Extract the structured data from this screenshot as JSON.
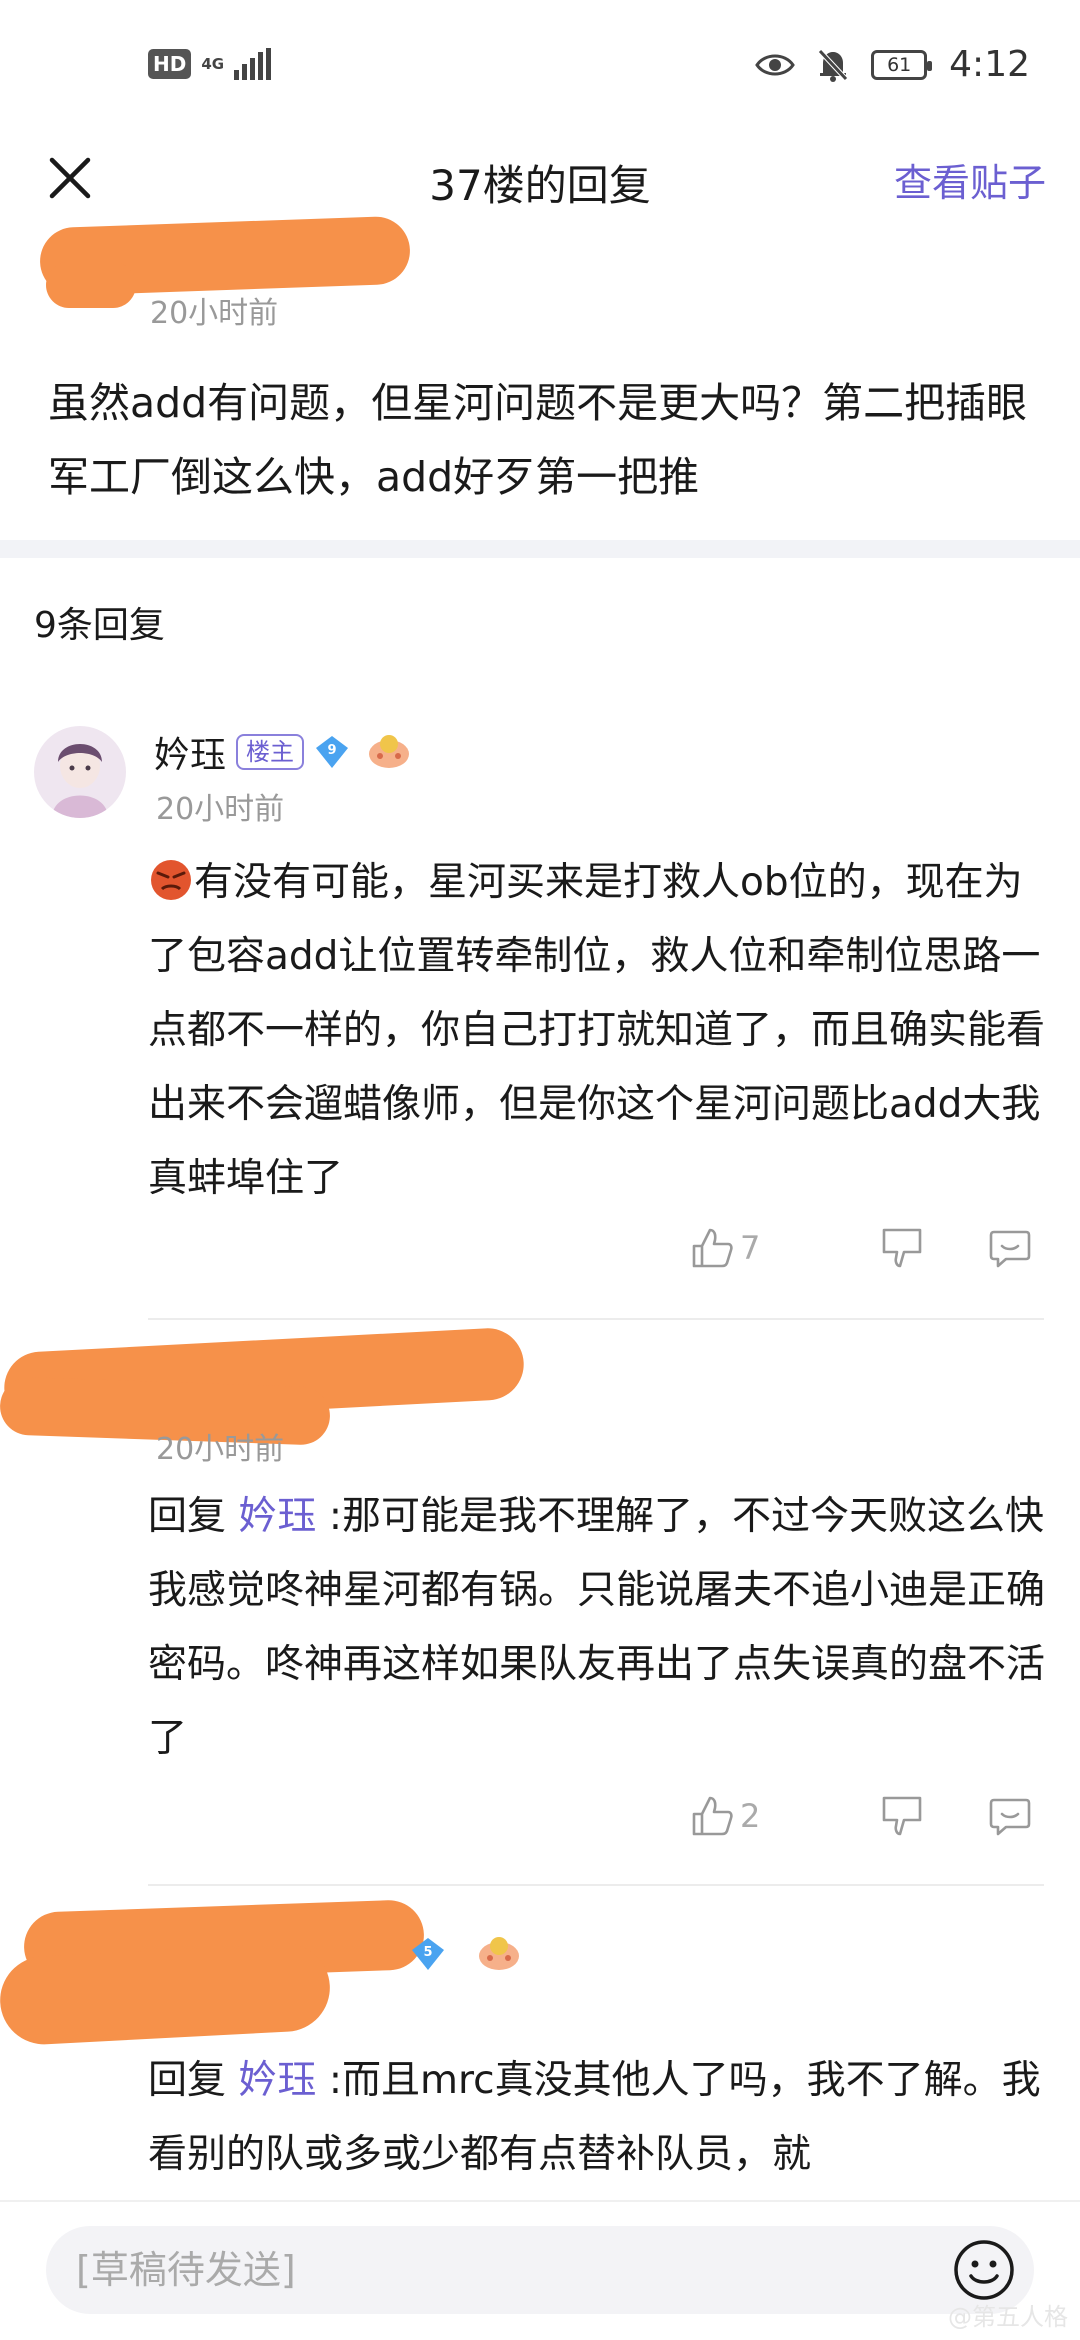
{
  "status": {
    "hd": "HD",
    "net": "4G",
    "battery": "61",
    "time": "4:12"
  },
  "nav": {
    "title": "37楼的回复",
    "link": "查看贴子"
  },
  "post": {
    "time": "20小时前",
    "text": "虽然add有问题，但星河问题不是更大吗？第二把插眼军工厂倒这么快，add好歹第一把推"
  },
  "reply_count": "9条回复",
  "replies": [
    {
      "name": "妗珏",
      "tag": "楼主",
      "level": "9",
      "time": "20小时前",
      "text": "有没有可能，星河买来是打救人ob位的，现在为了包容add让位置转牵制位，救人位和牵制位思路一点都不一样的，你自己打打就知道了，而且确实能看出来不会遛蜡像师，但是你这个星河问题比add大我真蚌埠住了",
      "likes": "7"
    },
    {
      "time": "20小时前",
      "prefix": "回复",
      "mention": "妗珏",
      "text": ":那可能是我不理解了，不过今天败这么快我感觉咚神星河都有锅。只能说屠夫不追小迪是正确密码。咚神再这样如果队友再出了点失误真的盘不活了",
      "likes": "2"
    },
    {
      "level": "5",
      "prefix": "回复",
      "mention": "妗珏",
      "text": ":而且mrc真没其他人了吗，我不了解。我看别的队或多或少都有点替补队员，就"
    }
  ],
  "bottom": {
    "placeholder": "[草稿待发送]"
  },
  "watermark": "@第五人格"
}
